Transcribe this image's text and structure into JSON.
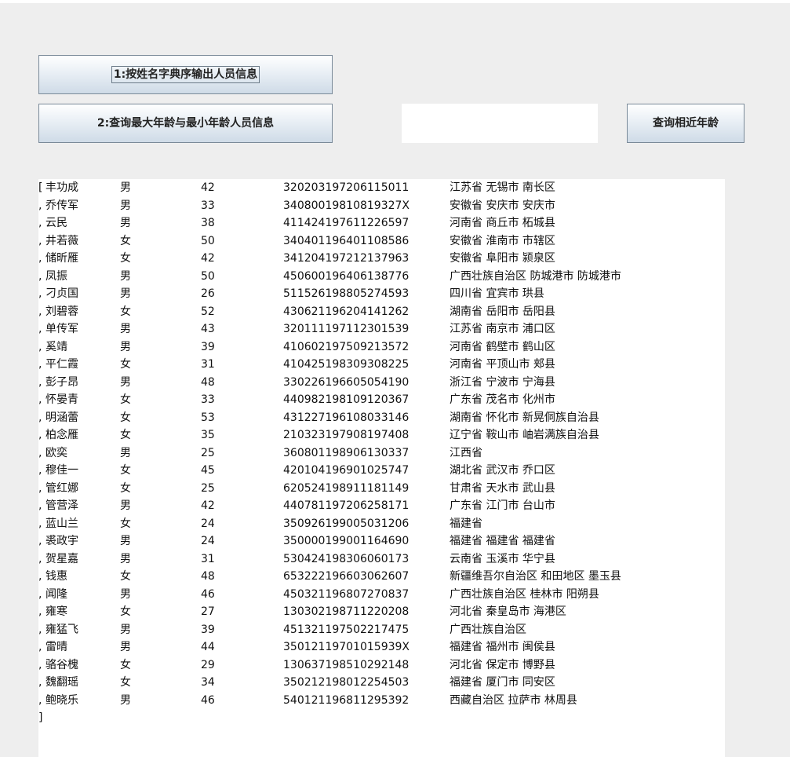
{
  "buttons": {
    "sort_by_name": "1:按姓名字典序输出人员信息",
    "query_max_min_age": "2:查询最大年龄与最小年龄人员信息",
    "query_similar_age": "查询相近年龄"
  },
  "age_input": {
    "value": ""
  },
  "output": {
    "close": "]",
    "rows": [
      {
        "prefix": "[",
        "name": "丰功成",
        "sex": "男",
        "age": "42",
        "id": "320203197206115011",
        "address": "江苏省 无锡市 南长区"
      },
      {
        "prefix": ",",
        "name": "乔传军",
        "sex": "男",
        "age": "33",
        "id": "34080019810819327X",
        "address": "安徽省 安庆市 安庆市"
      },
      {
        "prefix": ",",
        "name": "云民",
        "sex": "男",
        "age": "38",
        "id": "411424197611226597",
        "address": "河南省 商丘市 柘城县"
      },
      {
        "prefix": ",",
        "name": "井若薇",
        "sex": "女",
        "age": "50",
        "id": "340401196401108586",
        "address": "安徽省 淮南市 市辖区"
      },
      {
        "prefix": ",",
        "name": "储昕雁",
        "sex": "女",
        "age": "42",
        "id": "341204197212137963",
        "address": "安徽省 阜阳市 颍泉区"
      },
      {
        "prefix": ",",
        "name": "凤振",
        "sex": "男",
        "age": "50",
        "id": "450600196406138776",
        "address": "广西壮族自治区 防城港市 防城港市"
      },
      {
        "prefix": ",",
        "name": "刁贞国",
        "sex": "男",
        "age": "26",
        "id": "511526198805274593",
        "address": "四川省 宜宾市 珙县"
      },
      {
        "prefix": ",",
        "name": "刘碧蓉",
        "sex": "女",
        "age": "52",
        "id": "430621196204141262",
        "address": "湖南省 岳阳市 岳阳县"
      },
      {
        "prefix": ",",
        "name": "单传军",
        "sex": "男",
        "age": "43",
        "id": "320111197112301539",
        "address": "江苏省 南京市 浦口区"
      },
      {
        "prefix": ",",
        "name": "奚靖",
        "sex": "男",
        "age": "39",
        "id": "410602197509213572",
        "address": "河南省 鹤壁市 鹤山区"
      },
      {
        "prefix": ",",
        "name": "平仁霞",
        "sex": "女",
        "age": "31",
        "id": "410425198309308225",
        "address": "河南省 平顶山市 郏县"
      },
      {
        "prefix": ",",
        "name": "彭子昂",
        "sex": "男",
        "age": "48",
        "id": "330226196605054190",
        "address": "浙江省 宁波市 宁海县"
      },
      {
        "prefix": ",",
        "name": "怀晏青",
        "sex": "女",
        "age": "33",
        "id": "440982198109120367",
        "address": "广东省 茂名市 化州市"
      },
      {
        "prefix": ",",
        "name": "明涵蕾",
        "sex": "女",
        "age": "53",
        "id": "431227196108033146",
        "address": "湖南省 怀化市 新晃侗族自治县"
      },
      {
        "prefix": ",",
        "name": "柏念雁",
        "sex": "女",
        "age": "35",
        "id": "210323197908197408",
        "address": "辽宁省 鞍山市 岫岩满族自治县"
      },
      {
        "prefix": ",",
        "name": "欧奕",
        "sex": "男",
        "age": "25",
        "id": "360801198906130337",
        "address": "江西省"
      },
      {
        "prefix": ",",
        "name": "穆佳一",
        "sex": "女",
        "age": "45",
        "id": "420104196901025747",
        "address": "湖北省 武汉市 乔口区"
      },
      {
        "prefix": ",",
        "name": "管红娜",
        "sex": "女",
        "age": "25",
        "id": "620524198911181149",
        "address": "甘肃省 天水市 武山县"
      },
      {
        "prefix": ",",
        "name": "管营泽",
        "sex": "男",
        "age": "42",
        "id": "440781197206258171",
        "address": "广东省 江门市 台山市"
      },
      {
        "prefix": ",",
        "name": "蓝山兰",
        "sex": "女",
        "age": "24",
        "id": "350926199005031206",
        "address": "福建省"
      },
      {
        "prefix": ",",
        "name": "裘政宇",
        "sex": "男",
        "age": "24",
        "id": "350000199001164690",
        "address": "福建省 福建省 福建省"
      },
      {
        "prefix": ",",
        "name": "贺星嘉",
        "sex": "男",
        "age": "31",
        "id": "530424198306060173",
        "address": "云南省 玉溪市 华宁县"
      },
      {
        "prefix": ",",
        "name": "钱惠",
        "sex": "女",
        "age": "48",
        "id": "653222196603062607",
        "address": "新疆维吾尔自治区 和田地区 墨玉县"
      },
      {
        "prefix": ",",
        "name": "闻隆",
        "sex": "男",
        "age": "46",
        "id": "450321196807270837",
        "address": "广西壮族自治区 桂林市 阳朔县"
      },
      {
        "prefix": ",",
        "name": "雍寒",
        "sex": "女",
        "age": "27",
        "id": "130302198711220208",
        "address": "河北省 秦皇岛市 海港区"
      },
      {
        "prefix": ",",
        "name": "雍猛飞",
        "sex": "男",
        "age": "39",
        "id": "451321197502217475",
        "address": "广西壮族自治区"
      },
      {
        "prefix": ",",
        "name": "雷晴",
        "sex": "男",
        "age": "44",
        "id": "35012119701015939X",
        "address": "福建省 福州市 闽侯县"
      },
      {
        "prefix": ",",
        "name": "骆谷槐",
        "sex": "女",
        "age": "29",
        "id": "130637198510292148",
        "address": "河北省 保定市 博野县"
      },
      {
        "prefix": ",",
        "name": "魏翻瑶",
        "sex": "女",
        "age": "34",
        "id": "350212198012254503",
        "address": "福建省 厦门市 同安区"
      },
      {
        "prefix": ",",
        "name": "鲍晓乐",
        "sex": "男",
        "age": "46",
        "id": "540121196811295392",
        "address": "西藏自治区 拉萨市 林周县"
      }
    ]
  }
}
